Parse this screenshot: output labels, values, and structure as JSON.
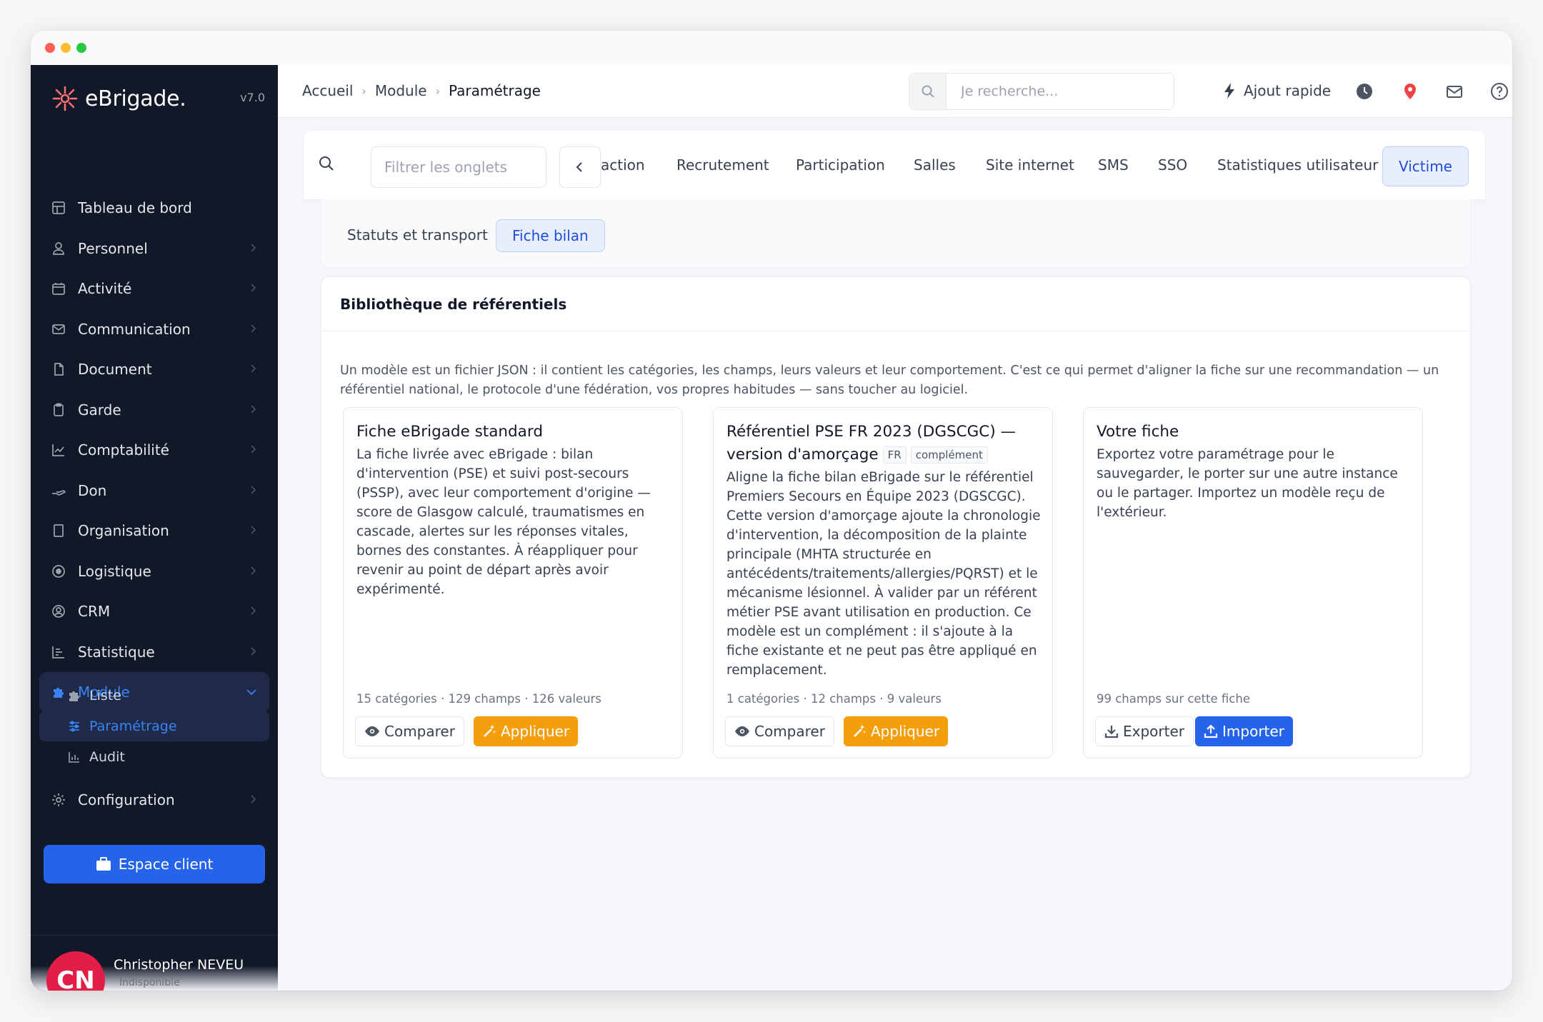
{
  "app": {
    "logo_text": "eBrigade.",
    "version": "v7.0"
  },
  "sidebar": {
    "items": [
      {
        "label": "Tableau de bord",
        "icon": "grid-icon"
      },
      {
        "label": "Personnel",
        "icon": "user-icon"
      },
      {
        "label": "Activité",
        "icon": "calendar-icon"
      },
      {
        "label": "Communication",
        "icon": "envelope-icon"
      },
      {
        "label": "Document",
        "icon": "document-icon"
      },
      {
        "label": "Garde",
        "icon": "clipboard-icon"
      },
      {
        "label": "Comptabilité",
        "icon": "chart-line-icon"
      },
      {
        "label": "Don",
        "icon": "hand-icon"
      },
      {
        "label": "Organisation",
        "icon": "building-icon"
      },
      {
        "label": "Logistique",
        "icon": "target-icon"
      },
      {
        "label": "CRM",
        "icon": "user-circle-icon"
      },
      {
        "label": "Statistique",
        "icon": "bar-chart-icon"
      },
      {
        "label": "Module",
        "icon": "puzzle-icon"
      }
    ],
    "module_subitems": [
      {
        "label": "Liste",
        "icon": "puzzle-icon"
      },
      {
        "label": "Paramétrage",
        "icon": "sliders-icon"
      },
      {
        "label": "Audit",
        "icon": "chart-icon"
      }
    ],
    "configuration_label": "Configuration",
    "espace_client_label": "Espace client",
    "user": {
      "initials": "CN",
      "name": "Christopher NEVEU",
      "status": "Indisponible"
    }
  },
  "topbar": {
    "breadcrumb": [
      "Accueil",
      "Module",
      "Paramétrage"
    ],
    "search_placeholder": "Je recherche...",
    "quick_add_label": "Ajout rapide"
  },
  "tabs": {
    "filter_placeholder": "Filtrer les onglets",
    "items": [
      "action",
      "Recrutement",
      "Participation",
      "Salles",
      "Site internet",
      "SMS",
      "SSO",
      "Statistiques utilisateur",
      "Victime"
    ],
    "active": "Victime"
  },
  "subtabs": {
    "items": [
      "Statuts et transport",
      "Fiche bilan"
    ],
    "active": "Fiche bilan"
  },
  "panel": {
    "title": "Bibliothèque de référentiels",
    "intro_line1": "Un modèle est un fichier JSON : il contient les catégories, les champs, leurs valeurs et leur comportement. C'est ce qui permet d'aligner la fiche sur une recommandation — un",
    "intro_line2": "référentiel national, le protocole d'une fédération, vos propres habitudes — sans toucher au logiciel.",
    "cards": [
      {
        "title": "Fiche eBrigade standard",
        "description": "La fiche livrée avec eBrigade : bilan d'intervention (PSE) et suivi post-secours (PSSP), avec leur comportement d'origine — score de Glasgow calculé, traumatismes en cascade, alertes sur les réponses vitales, bornes des constantes. À réappliquer pour revenir au point de départ après avoir expérimenté.",
        "meta": "15 catégories · 129 champs · 126 valeurs",
        "btn1": "Comparer",
        "btn2": "Appliquer"
      },
      {
        "title_line1": "Référentiel PSE FR 2023 (DGSCGC) —",
        "title_line2": "version d'amorçage",
        "badge1": "FR",
        "badge2": "complément",
        "description": "Aligne la fiche bilan eBrigade sur le référentiel Premiers Secours en Équipe 2023 (DGSCGC). Cette version d'amorçage ajoute la chronologie d'intervention, la décomposition de la plainte principale (MHTA structurée en antécédents/traitements/allergies/PQRST) et le mécanisme lésionnel. À valider par un référent métier PSE avant utilisation en production. Ce modèle est un complément : il s'ajoute à la fiche existante et ne peut pas être appliqué en remplacement.",
        "meta": "1 catégories · 12 champs · 9 valeurs",
        "btn1": "Comparer",
        "btn2": "Appliquer"
      },
      {
        "title": "Votre fiche",
        "description": "Exportez votre paramétrage pour le sauvegarder, le porter sur une autre instance ou le partager. Importez un modèle reçu de l'extérieur.",
        "meta": "99 champs sur cette fiche",
        "btn1": "Exporter",
        "btn2": "Importer"
      }
    ]
  },
  "colors": {
    "sidebar_bg": "#111827",
    "accent": "#2563eb",
    "warning": "#f59e0b",
    "active_tab_bg": "#e8eefc"
  }
}
